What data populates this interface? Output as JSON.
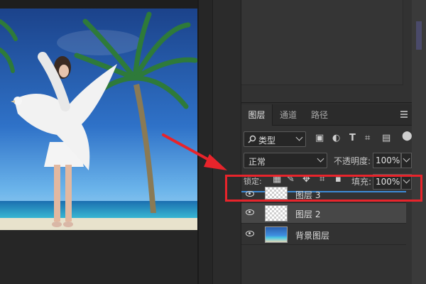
{
  "colors": {
    "accent": "#e8242b",
    "selection": "#3d8ad6",
    "panel_bg": "#323232",
    "sky_top": "#1e4f96",
    "sea": "#2a8fc8",
    "sand": "#e8e2cc"
  },
  "layers_panel": {
    "tabs": [
      {
        "label": "图层",
        "active": true
      },
      {
        "label": "通道",
        "active": false
      },
      {
        "label": "路径",
        "active": false
      }
    ],
    "menu_icon": "hamburger-menu-icon",
    "filter": {
      "search_icon": "search-icon",
      "label": "类型",
      "icons": [
        "image-icon",
        "adjustment-icon",
        "text-icon",
        "shape-icon",
        "smart-object-icon"
      ]
    },
    "blend_mode": "正常",
    "opacity_label": "不透明度:",
    "opacity_value": "100%",
    "lock_label": "锁定:",
    "lock_icons": [
      "lock-transparent-icon",
      "lock-paint-icon",
      "lock-move-icon",
      "lock-artboard-icon",
      "lock-all-icon"
    ],
    "fill_label": "填充:",
    "fill_value": "100%",
    "layers": [
      {
        "name": "图层 3",
        "thumb": "checker",
        "selected": false,
        "partial": true
      },
      {
        "name": "图层 2",
        "thumb": "checker",
        "selected": true,
        "partial": false
      },
      {
        "name": "背景图层",
        "thumb": "photo",
        "selected": false,
        "partial": false
      }
    ]
  },
  "canvas": {
    "icons": [
      "palm-tree-icon",
      "woman-figure-icon",
      "dove-icon"
    ]
  }
}
